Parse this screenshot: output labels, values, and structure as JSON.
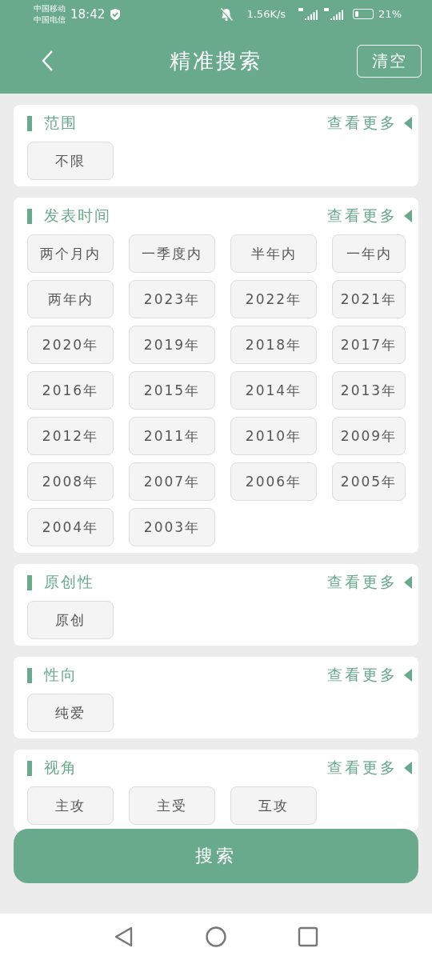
{
  "status_bar": {
    "carrier_1": "中国移动",
    "carrier_2": "中国电信",
    "time": "18:42",
    "speed": "1.56K/s",
    "battery": "21%"
  },
  "header": {
    "title": "精准搜索",
    "clear_button": "清空"
  },
  "sections": [
    {
      "title": "范围",
      "more": "查看更多",
      "options": [
        {
          "label": "不限",
          "selected": false
        }
      ]
    },
    {
      "title": "发表时间",
      "more": "查看更多",
      "options": [
        {
          "label": "两个月内",
          "selected": false
        },
        {
          "label": "一季度内",
          "selected": false
        },
        {
          "label": "半年内",
          "selected": false
        },
        {
          "label": "一年内",
          "selected": false
        },
        {
          "label": "两年内",
          "selected": false
        },
        {
          "label": "2023年",
          "selected": false
        },
        {
          "label": "2022年",
          "selected": false
        },
        {
          "label": "2021年",
          "selected": false
        },
        {
          "label": "2020年",
          "selected": false
        },
        {
          "label": "2019年",
          "selected": false
        },
        {
          "label": "2018年",
          "selected": false
        },
        {
          "label": "2017年",
          "selected": false
        },
        {
          "label": "2016年",
          "selected": false
        },
        {
          "label": "2015年",
          "selected": false
        },
        {
          "label": "2014年",
          "selected": false
        },
        {
          "label": "2013年",
          "selected": false
        },
        {
          "label": "2012年",
          "selected": false
        },
        {
          "label": "2011年",
          "selected": false
        },
        {
          "label": "2010年",
          "selected": false
        },
        {
          "label": "2009年",
          "selected": false
        },
        {
          "label": "2008年",
          "selected": false
        },
        {
          "label": "2007年",
          "selected": false
        },
        {
          "label": "2006年",
          "selected": false
        },
        {
          "label": "2005年",
          "selected": false
        },
        {
          "label": "2004年",
          "selected": false
        },
        {
          "label": "2003年",
          "selected": false
        }
      ]
    },
    {
      "title": "原创性",
      "more": "查看更多",
      "options": [
        {
          "label": "原创",
          "selected": false
        }
      ]
    },
    {
      "title": "性向",
      "more": "查看更多",
      "options": [
        {
          "label": "纯爱",
          "selected": false
        }
      ]
    },
    {
      "title": "视角",
      "more": "查看更多",
      "options": [
        {
          "label": "主攻",
          "selected": false
        },
        {
          "label": "主受",
          "selected": false
        },
        {
          "label": "互攻",
          "selected": false
        }
      ]
    }
  ],
  "search_button": "搜索"
}
